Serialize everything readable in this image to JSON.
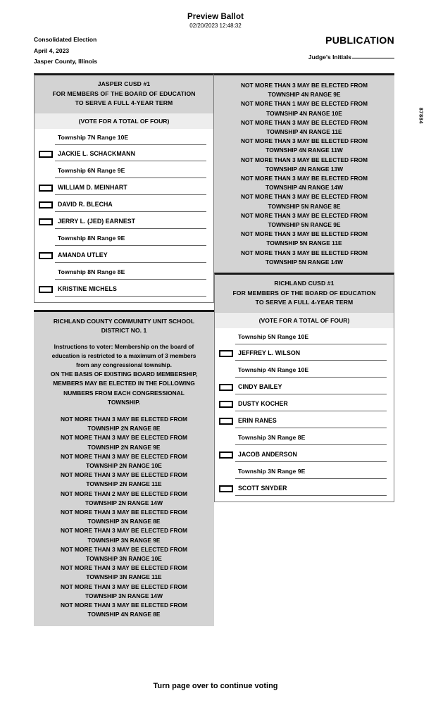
{
  "header": {
    "preview_title": "Preview Ballot",
    "timestamp": "02/20/2023 12:48:32",
    "election_name": "Consolidated Election",
    "election_date": "April 4, 2023",
    "jurisdiction": "Jasper County, Illinois",
    "publication_label": "PUBLICATION",
    "judge_initials_label": "Judge's Initials"
  },
  "side_code": "87884",
  "footer": {
    "note": "Turn page over to continue voting"
  },
  "contests": [
    {
      "id": "jasper-cusd-1",
      "title_lines": [
        "JASPER CUSD #1",
        "FOR MEMBERS OF THE BOARD OF EDUCATION",
        "TO SERVE A FULL 4-YEAR TERM"
      ],
      "vote_for": "(VOTE FOR A TOTAL OF FOUR)",
      "rows": [
        {
          "type": "township",
          "text": "Township 7N Range 10E"
        },
        {
          "type": "candidate",
          "text": "JACKIE L. SCHACKMANN"
        },
        {
          "type": "township",
          "text": "Township 6N Range 9E"
        },
        {
          "type": "candidate",
          "text": "WILLIAM D. MEINHART"
        },
        {
          "type": "candidate",
          "text": "DAVID R. BLECHA"
        },
        {
          "type": "candidate",
          "text": "JERRY L. (JED) EARNEST"
        },
        {
          "type": "township",
          "text": "Township 8N Range 9E"
        },
        {
          "type": "candidate",
          "text": "AMANDA UTLEY"
        },
        {
          "type": "township",
          "text": "Township 8N Range 8E"
        },
        {
          "type": "candidate",
          "text": "KRISTINE MICHELS"
        }
      ]
    },
    {
      "id": "richland-cusd-1",
      "title_lines": [
        "RICHLAND CUSD #1",
        "FOR MEMBERS OF THE BOARD OF EDUCATION",
        "TO SERVE A FULL 4-YEAR TERM"
      ],
      "vote_for": "(VOTE FOR A TOTAL OF FOUR)",
      "rows": [
        {
          "type": "township",
          "text": "Township 5N Range 10E"
        },
        {
          "type": "candidate",
          "text": "JEFFREY L. WILSON"
        },
        {
          "type": "township",
          "text": "Township 4N Range 10E"
        },
        {
          "type": "candidate",
          "text": "CINDY BAILEY"
        },
        {
          "type": "candidate",
          "text": "DUSTY KOCHER"
        },
        {
          "type": "candidate",
          "text": "ERIN RANES"
        },
        {
          "type": "township",
          "text": "Township 3N Range 8E"
        },
        {
          "type": "candidate",
          "text": "JACOB ANDERSON"
        },
        {
          "type": "township",
          "text": "Township 3N Range 9E"
        },
        {
          "type": "candidate",
          "text": "SCOTT SNYDER"
        }
      ]
    }
  ],
  "instructions": {
    "title_lines": [
      "RICHLAND COUNTY COMMUNITY UNIT SCHOOL",
      "DISTRICT NO. 1"
    ],
    "paragraph_lines": [
      "Instructions to voter: Membership on the board of",
      "education is restricted to a maximum of 3 members",
      "from any congressional township."
    ],
    "upper_lines": [
      "ON THE BASIS OF EXISTING BOARD MEMBERSHIP,",
      "MEMBERS MAY BE ELECTED IN THE FOLLOWING",
      "NUMBERS FROM EACH CONGRESSIONAL",
      "TOWNSHIP."
    ],
    "limits_left": [
      {
        "line1": "NOT MORE THAN 3 MAY BE ELECTED FROM",
        "line2": "TOWNSHIP 2N RANGE 8E"
      },
      {
        "line1": "NOT MORE THAN 3 MAY BE ELECTED FROM",
        "line2": "TOWNSHIP 2N RANGE 9E"
      },
      {
        "line1": "NOT MORE THAN 3 MAY BE ELECTED FROM",
        "line2": "TOWNSHIP 2N RANGE 10E"
      },
      {
        "line1": "NOT MORE THAN 3 MAY BE ELECTED FROM",
        "line2": "TOWNSHIP 2N RANGE 11E"
      },
      {
        "line1": "NOT MORE THAN 2 MAY BE ELECTED FROM",
        "line2": "TOWNSHIP 2N RANGE 14W"
      },
      {
        "line1": "NOT MORE THAN 3 MAY BE ELECTED FROM",
        "line2": "TOWNSHIP 3N RANGE 8E"
      },
      {
        "line1": "NOT MORE THAN 3 MAY BE ELECTED FROM",
        "line2": "TOWNSHIP 3N RANGE 9E"
      },
      {
        "line1": "NOT MORE THAN 3 MAY BE ELECTED FROM",
        "line2": "TOWNSHIP 3N RANGE 10E"
      },
      {
        "line1": "NOT MORE THAN 3 MAY BE ELECTED FROM",
        "line2": "TOWNSHIP 3N RANGE 11E"
      },
      {
        "line1": "NOT MORE THAN 3 MAY BE ELECTED FROM",
        "line2": "TOWNSHIP 3N RANGE 14W"
      },
      {
        "line1": "NOT MORE THAN 3 MAY BE ELECTED FROM",
        "line2": "TOWNSHIP 4N RANGE 8E"
      }
    ],
    "limits_right": [
      {
        "line1": "NOT MORE THAN 3 MAY BE ELECTED FROM",
        "line2": "TOWNSHIP 4N RANGE 9E"
      },
      {
        "line1": "NOT MORE THAN 1 MAY BE ELECTED FROM",
        "line2": "TOWNSHIP 4N RANGE 10E"
      },
      {
        "line1": "NOT MORE THAN 3 MAY BE ELECTED FROM",
        "line2": "TOWNSHIP 4N RANGE 11E"
      },
      {
        "line1": "NOT MORE THAN 3 MAY BE ELECTED FROM",
        "line2": "TOWNSHIP 4N RANGE 11W"
      },
      {
        "line1": "NOT MORE THAN 3 MAY BE ELECTED FROM",
        "line2": "TOWNSHIP 4N RANGE 13W"
      },
      {
        "line1": "NOT MORE THAN 3 MAY BE ELECTED FROM",
        "line2": "TOWNSHIP 4N RANGE 14W"
      },
      {
        "line1": "NOT MORE THAN 3 MAY BE ELECTED FROM",
        "line2": "TOWNSHIP 5N RANGE 8E"
      },
      {
        "line1": "NOT MORE THAN 3 MAY BE ELECTED FROM",
        "line2": "TOWNSHIP 5N RANGE 9E"
      },
      {
        "line1": "NOT MORE THAN 3 MAY BE ELECTED FROM",
        "line2": "TOWNSHIP 5N RANGE 11E"
      },
      {
        "line1": "NOT MORE THAN 3 MAY BE ELECTED FROM",
        "line2": "TOWNSHIP 5N RANGE 14W"
      }
    ]
  }
}
